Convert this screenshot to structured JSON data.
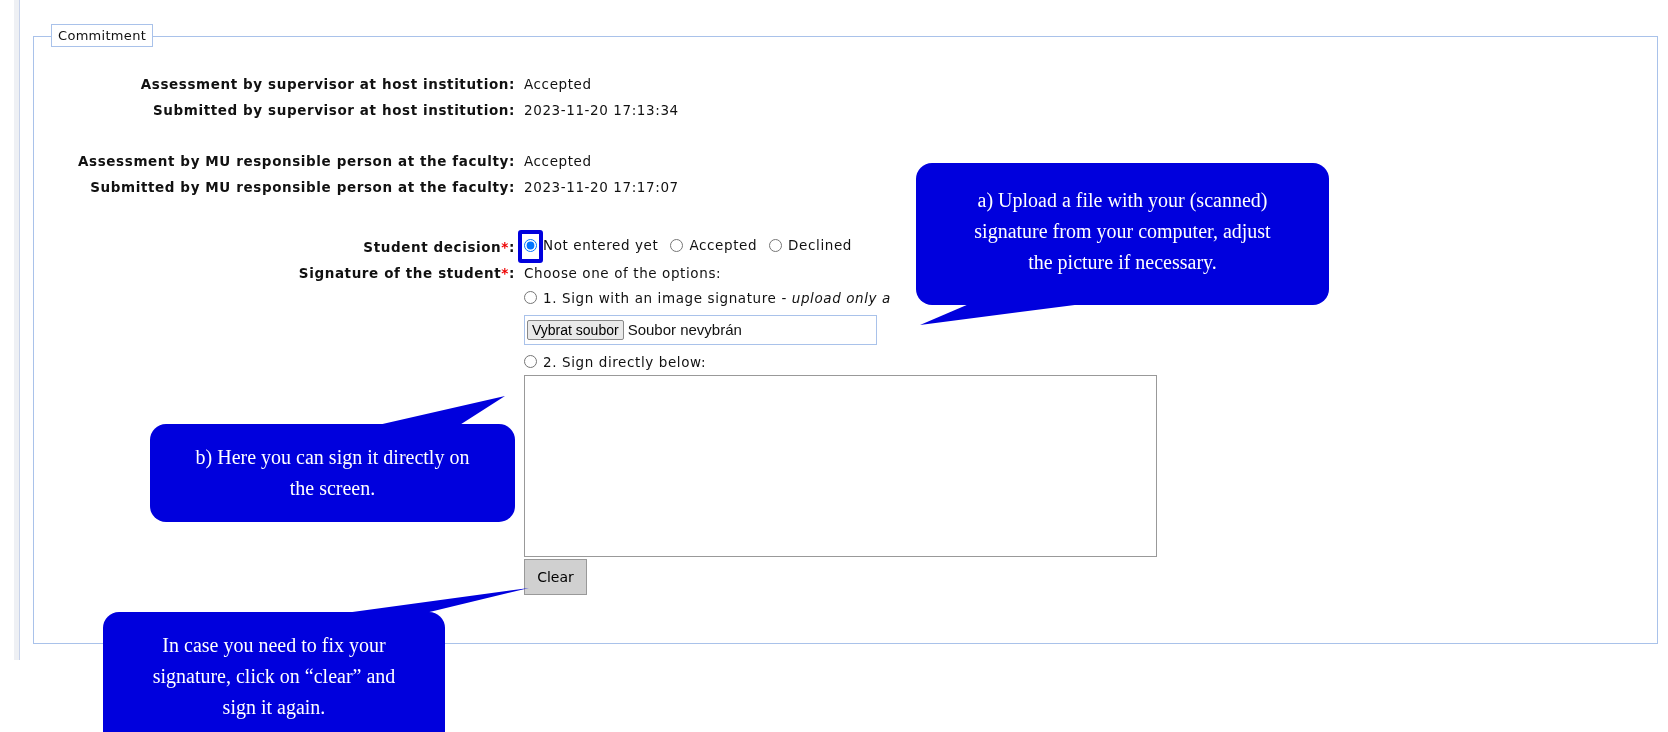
{
  "fieldset": {
    "legend": "Commitment"
  },
  "info_groups": [
    [
      {
        "label": "Assessment by supervisor at host institution:",
        "value": "Accepted"
      },
      {
        "label": "Submitted by supervisor at host institution:",
        "value": "2023-11-20 17:13:34"
      }
    ],
    [
      {
        "label": "Assessment by MU responsible person at the faculty:",
        "value": "Accepted"
      },
      {
        "label": "Submitted by MU responsible person at the faculty:",
        "value": "2023-11-20 17:17:07"
      }
    ]
  ],
  "student_decision": {
    "label": "Student decision",
    "required_mark": "*",
    "colon": ":",
    "options": [
      {
        "label": "Not entered yet",
        "selected": true,
        "highlighted": true
      },
      {
        "label": "Accepted",
        "selected": false,
        "highlighted": false
      },
      {
        "label": "Declined",
        "selected": false,
        "highlighted": false
      }
    ]
  },
  "signature": {
    "label": "Signature of the student",
    "required_mark": "*",
    "colon": ":",
    "hint": "Choose one of the options:",
    "options": [
      {
        "label": "1. Sign with an image signature - *upload only a*",
        "selected": false
      },
      {
        "label": "2. Sign directly below:",
        "selected": false
      }
    ],
    "file_button": "Vybrat soubor",
    "file_status": "Soubor nevybrán",
    "clear_button": "Clear"
  },
  "callouts": [
    {
      "text": "a) Upload a file with your (scanned) signature from your computer, adjust the picture if necessary."
    },
    {
      "text": "b) Here you can sign it directly on the screen."
    },
    {
      "text": "In case you need to fix your signature, click on “clear” and sign it again."
    }
  ]
}
